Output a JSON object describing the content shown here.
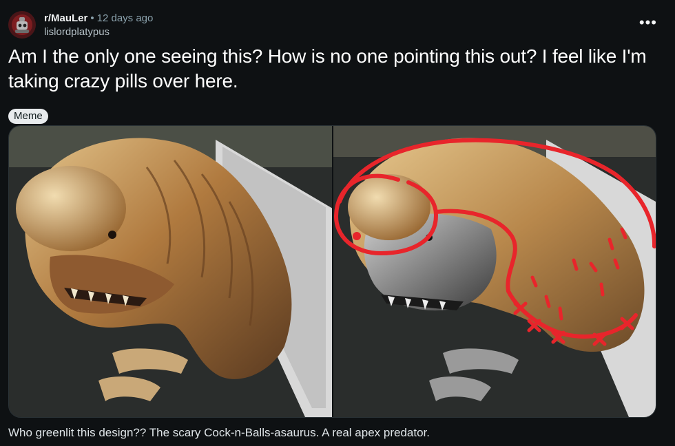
{
  "post": {
    "subreddit": "r/MauLer",
    "separator": "•",
    "age": "12 days ago",
    "username": "lislordplatypus",
    "title": "Am I the only one seeing this? How is no one pointing this out? I feel like I'm taking crazy pills over here.",
    "flair": "Meme",
    "caption": "Who greenlit this design?? The scary Cock-n-Balls-asaurus. A real apex predator.",
    "overflow_icon": "more-horizontal-icon"
  },
  "colors": {
    "background": "#0e1113",
    "annotation_red": "#e8252b",
    "flair_bg": "#e8ebed"
  }
}
